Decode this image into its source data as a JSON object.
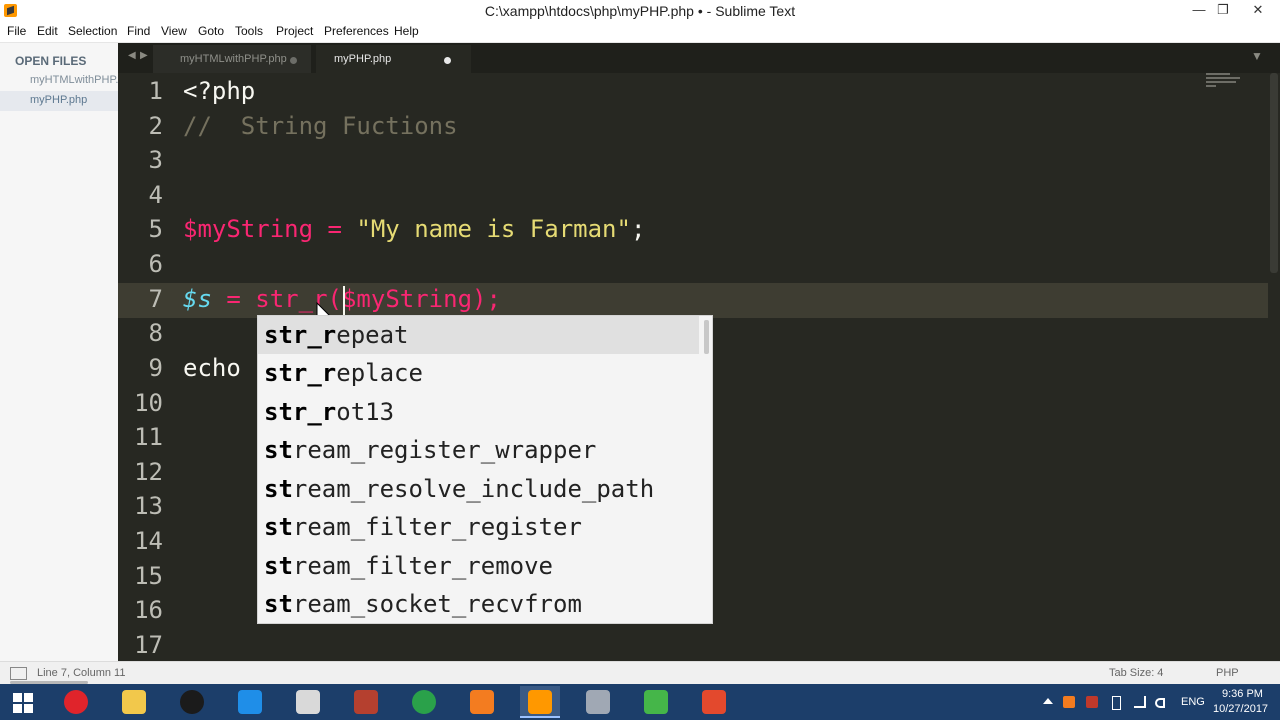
{
  "window": {
    "title": "C:\\xampp\\htdocs\\php\\myPHP.php • - Sublime Text",
    "minimize": "—",
    "maximize": "❐",
    "close": "✕"
  },
  "menu": [
    "File",
    "Edit",
    "Selection",
    "Find",
    "View",
    "Goto",
    "Tools",
    "Project",
    "Preferences",
    "Help"
  ],
  "sidebar": {
    "title": "OPEN FILES",
    "files": [
      "myHTMLwithPHP.php",
      "myPHP.php"
    ]
  },
  "tabs": [
    {
      "label": "myHTMLwithPHP.php"
    },
    {
      "label": "myPHP.php"
    }
  ],
  "editor": {
    "line_numbers": [
      "1",
      "2",
      "3",
      "4",
      "5",
      "6",
      "7",
      "8",
      "9",
      "10",
      "11",
      "12",
      "13",
      "14",
      "15",
      "16",
      "17"
    ],
    "lines": {
      "l1": "<?php",
      "l2": "//  String Fuctions",
      "l5_var": "$myString",
      "l5_eq": " = ",
      "l5_str": "\"My name is Farman\"",
      "l5_end": ";",
      "l7_var": "$s",
      "l7_eq": " = ",
      "l7_fn": "str_r",
      "l7_open": "(",
      "l7_arg": "$myString",
      "l7_close": ");",
      "l9": "echo"
    },
    "active_line": 7
  },
  "autocomplete": {
    "items": [
      {
        "match": "str_r",
        "rest": "epeat"
      },
      {
        "match": "str_r",
        "rest": "eplace"
      },
      {
        "match": "str_r",
        "rest": "ot13"
      },
      {
        "match": "st",
        "rest": "ream_register_wrapper"
      },
      {
        "match": "st",
        "rest": "ream_resolve_include_path"
      },
      {
        "match": "st",
        "rest": "ream_filter_register"
      },
      {
        "match": "st",
        "rest": "ream_filter_remove"
      },
      {
        "match": "st",
        "rest": "ream_socket_recvfrom"
      }
    ],
    "selected_index": 0
  },
  "statusbar": {
    "position": "Line 7, Column 11",
    "tab_size": "Tab Size: 4",
    "syntax": "PHP"
  },
  "taskbar": {
    "apps": [
      {
        "name": "opera",
        "color": "#e0242b"
      },
      {
        "name": "file-explorer",
        "color": "#f2c84b"
      },
      {
        "name": "github",
        "color": "#1b1b1b"
      },
      {
        "name": "outlook",
        "color": "#1f8ee8"
      },
      {
        "name": "paint",
        "color": "#d9d9d9"
      },
      {
        "name": "filezilla",
        "color": "#b5402f"
      },
      {
        "name": "chrome",
        "color": "#2aa14a"
      },
      {
        "name": "xampp",
        "color": "#f37c20"
      },
      {
        "name": "sublime-text",
        "color": "#ff9800"
      },
      {
        "name": "network-tool",
        "color": "#a0a8b4"
      },
      {
        "name": "camtasia",
        "color": "#45b649"
      },
      {
        "name": "camtasia-recorder",
        "color": "#e3492d"
      }
    ],
    "language": "ENG",
    "time": "9:36 PM",
    "date": "10/27/2017"
  }
}
